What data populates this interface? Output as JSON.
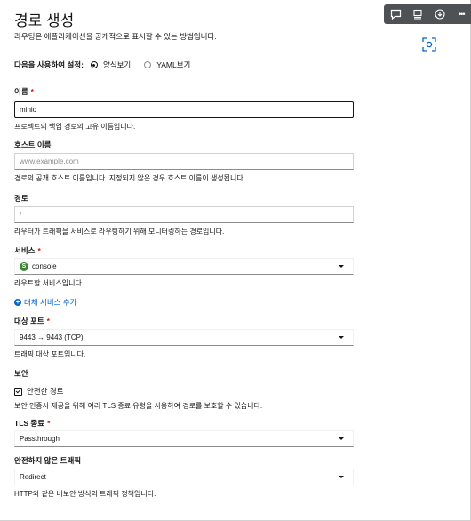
{
  "page": {
    "title": "경로 생성",
    "subtitle": "라우팅은 애플리케이션을 공개적으로 표시할 수 있는 방법입니다."
  },
  "toolbar": {
    "icons": [
      "chat-icon",
      "list-icon",
      "download-icon",
      "more-icon"
    ],
    "more_label": "•••"
  },
  "configure": {
    "label": "다음을 사용하여 설정:",
    "options": [
      "양식보기",
      "YAML보기"
    ],
    "selected": "양식보기"
  },
  "name": {
    "label": "이름",
    "required_mark": "*",
    "value": "minio",
    "help": "프로젝트의 백업 경로의 고유 이름입니다."
  },
  "hostname": {
    "label": "호스트 이름",
    "placeholder": "www.example.com",
    "help": "경로의 공개 호스트 이름입니다. 지정되지 않은 경우 호스트 이름이 생성됩니다."
  },
  "path": {
    "label": "경로",
    "placeholder": "/",
    "help": "라우터가 트래픽을 서비스로 라우팅하기 위해 모니터링하는 경로입니다."
  },
  "service": {
    "label": "서비스",
    "required_mark": "*",
    "badge": "S",
    "value": "console",
    "help": "라우트할 서비스입니다."
  },
  "add_service_link": "대체 서비스 추가",
  "target_port": {
    "label": "대상 포트",
    "required_mark": "*",
    "value": "9443 → 9443 (TCP)",
    "help": "트래픽 대상 포트입니다."
  },
  "security": {
    "label": "보안",
    "checkbox_label": "안전한 경로",
    "checked": true,
    "help": "보안 인증서 제공을 위해 여러 TLS 종료 유형을 사용하여 경로를 보호할 수 있습니다."
  },
  "tls_termination": {
    "label": "TLS 종료",
    "required_mark": "*",
    "value": "Passthrough"
  },
  "insecure_traffic": {
    "label": "안전하지 않은 트래픽",
    "value": "Redirect",
    "help": "HTTP와 같은 비보안 방식의 트래픽 정책입니다."
  },
  "colors": {
    "link": "#0066cc",
    "required": "#c9190b",
    "toolbar": "#4f5255",
    "service_badge": "#3e8635"
  }
}
